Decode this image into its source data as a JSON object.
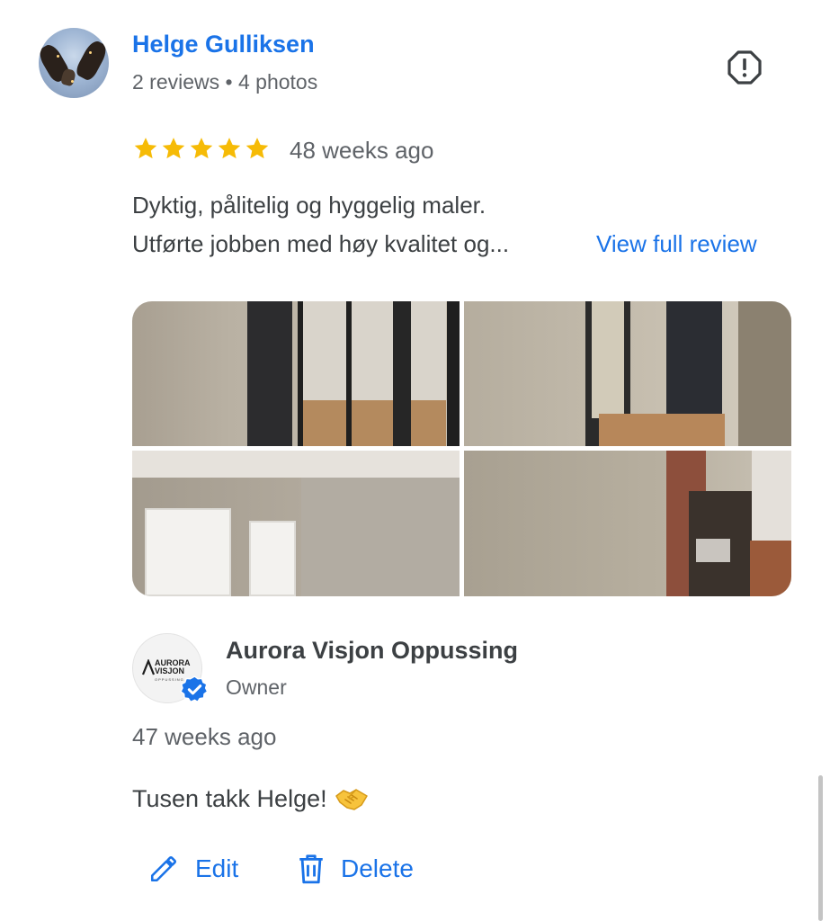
{
  "review": {
    "reviewer_name": "Helge Gulliksen",
    "reviewer_meta": "2 reviews • 4 photos",
    "rating": 5,
    "max_rating": 5,
    "time_ago": "48 weeks ago",
    "text_line1": "Dyktig, pålitelig og hyggelig maler.",
    "text_line2": "Utførte jobben med høy kvalitet og...",
    "view_full_label": "View full review",
    "photo_count": 4
  },
  "owner_response": {
    "name": "Aurora Visjon Oppussing",
    "role": "Owner",
    "logo_line1": "AURORA",
    "logo_line2": "VISJON",
    "logo_sub": "OPPUSSING",
    "time_ago": "47 weeks ago",
    "reply_text": "Tusen takk Helge!"
  },
  "actions": {
    "edit_label": "Edit",
    "delete_label": "Delete"
  },
  "icons": {
    "flag": "report-flag-icon",
    "star": "star-icon",
    "verified": "verified-badge-icon",
    "edit": "pencil-icon",
    "delete": "trash-icon",
    "emoji": "handshake-icon"
  },
  "colors": {
    "link": "#1a73e8",
    "star": "#f6bb06",
    "text_primary": "#3c4043",
    "text_secondary": "#5f6368"
  }
}
